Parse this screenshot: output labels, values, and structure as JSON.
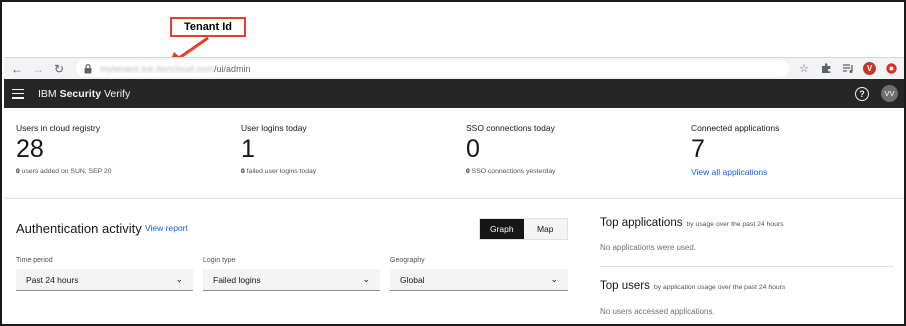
{
  "annotation": {
    "label": "Tenant Id"
  },
  "browser": {
    "url_host": "mytenant.ice.ibmcloud.com",
    "url_path": "/ui/admin",
    "profile_initial": "V"
  },
  "app": {
    "brand_prefix": "IBM ",
    "brand_bold": "Security",
    "brand_suffix": " Verify",
    "help": "?",
    "avatar": "VV"
  },
  "stats": [
    {
      "label": "Users in cloud registry",
      "value": "28",
      "sub_count": "0",
      "sub_text": " users added on SUN, SEP 20"
    },
    {
      "label": "User logins today",
      "value": "1",
      "sub_count": "0",
      "sub_text": " failed user logins today"
    },
    {
      "label": "SSO connections today",
      "value": "0",
      "sub_count": "0",
      "sub_text": " SSO connections yesterday"
    },
    {
      "label": "Connected applications",
      "value": "7",
      "link": "View all applications"
    }
  ],
  "auth_activity": {
    "title": "Authentication activity",
    "view_report": "View report",
    "toggle": {
      "graph": "Graph",
      "map": "Map",
      "selected": "Graph"
    },
    "filters": {
      "time_period": {
        "label": "Time period",
        "value": "Past 24 hours"
      },
      "login_type": {
        "label": "Login type",
        "value": "Failed logins"
      },
      "geography": {
        "label": "Geography",
        "value": "Global"
      }
    }
  },
  "top_applications": {
    "title": "Top applications",
    "subtitle": "by usage over the past 24 hours",
    "empty": "No applications were used."
  },
  "top_users": {
    "title": "Top users",
    "subtitle": "by application usage over the past 24 hours",
    "empty": "No users accessed applications."
  },
  "colors": {
    "accent": "#0f62fe",
    "header": "#262626",
    "callout": "#e0412b"
  }
}
